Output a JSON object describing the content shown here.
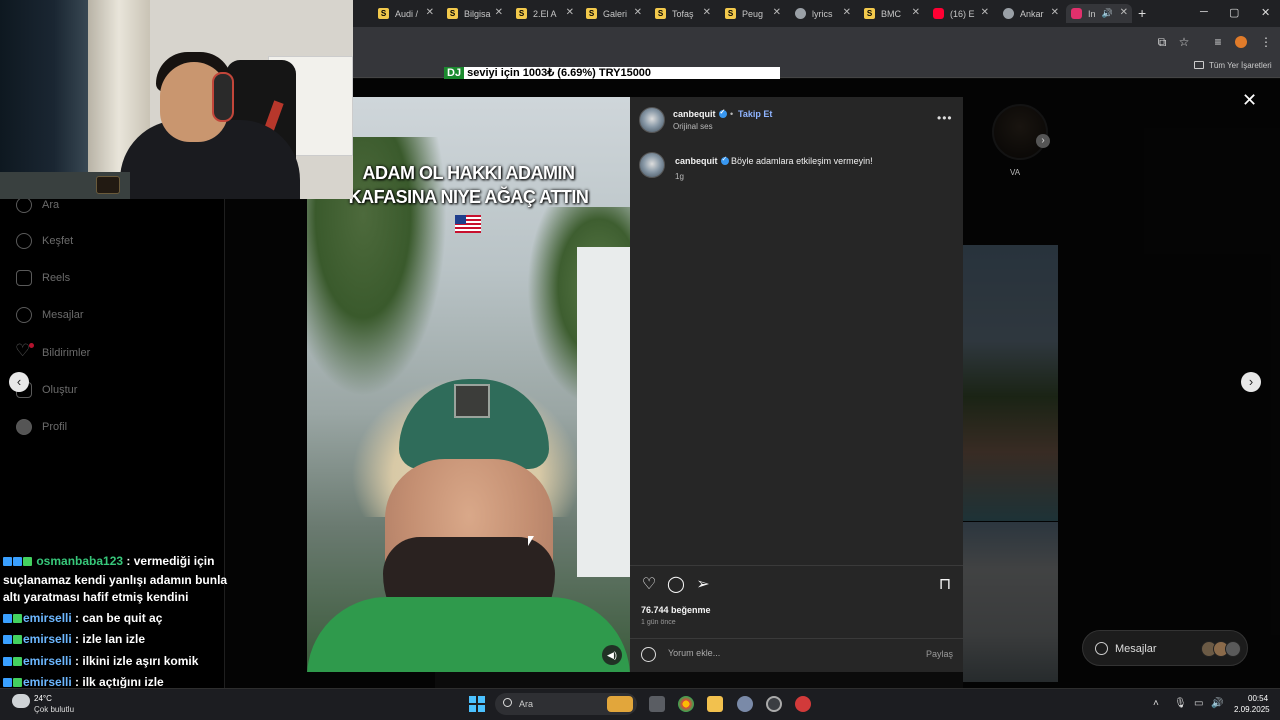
{
  "browser": {
    "tabs": [
      {
        "label": "Audi /",
        "color": "#f2c94c",
        "glyph": "S"
      },
      {
        "label": "Bilgisa",
        "color": "#f2c94c",
        "glyph": "S"
      },
      {
        "label": "2.El A",
        "color": "#f2c94c",
        "glyph": "S"
      },
      {
        "label": "Galeri",
        "color": "#f2c94c",
        "glyph": "S"
      },
      {
        "label": "Tofaş",
        "color": "#f2c94c",
        "glyph": "S"
      },
      {
        "label": "Peug",
        "color": "#f2c94c",
        "glyph": "S"
      },
      {
        "label": "lyrics",
        "color": "#9aa0a6",
        "glyph": ""
      },
      {
        "label": "BMC",
        "color": "#f2c94c",
        "glyph": "S"
      },
      {
        "label": "(16) E",
        "color": "#ff0033",
        "glyph": ""
      },
      {
        "label": "Ankar",
        "color": "#9aa0a6",
        "glyph": ""
      },
      {
        "label": "In",
        "color": "#e1306c",
        "glyph": ""
      }
    ],
    "bookmarks_all": "Tüm Yer İşaretleri"
  },
  "ticker": {
    "dj": "DJ",
    "text": " seviyi için          1003₺ (6.69%)           TRY15000"
  },
  "sidebar": {
    "items": [
      {
        "label": "Ara",
        "icon": "search-icon"
      },
      {
        "label": "Keşfet",
        "icon": "compass-icon"
      },
      {
        "label": "Reels",
        "icon": "reels-icon"
      },
      {
        "label": "Mesajlar",
        "icon": "messenger-icon"
      },
      {
        "label": "Bildirimler",
        "icon": "heart-icon"
      },
      {
        "label": "Oluştur",
        "icon": "plus-icon"
      },
      {
        "label": "Profil",
        "icon": "profile-icon"
      }
    ]
  },
  "profile": {
    "story_label": "VA"
  },
  "post": {
    "video_caption_line1": "ADAM OL HAKKI ADAMIN",
    "video_caption_line2": "KAFASINA NIYE AĞAÇ ATTIN",
    "username": "canbequit",
    "follow_label": "Takip Et",
    "audio": "Orijinal ses",
    "comment": "Böyle adamlara etkileşim vermeyin!",
    "comment_age": "1g",
    "likes": "76.744 beğenme",
    "posted_ago": "1 gün önce",
    "comment_placeholder": "Yorum ekle...",
    "share_label": "Paylaş"
  },
  "messages_pill": {
    "label": "Mesajlar"
  },
  "chat": {
    "messages": [
      {
        "user": "osmanbaba123",
        "text": ": vermediği için suçlanamaz kendi yanlışı adamın bunla altı yaratması hafif etmiş kendini"
      },
      {
        "user": "emirselli",
        "text": ": can be quit aç"
      },
      {
        "user": "emirselli",
        "text": ": izle lan izle"
      },
      {
        "user": "emirselli",
        "text": ": ilkini izle aşırı komik"
      },
      {
        "user": "emirselli",
        "text": ": ilk açtığını izle"
      }
    ]
  },
  "taskbar": {
    "temp": "24°C",
    "weather": "Çok bulutlu",
    "search_label": "Ara",
    "time": "00:54",
    "date": "2.09.2025"
  }
}
